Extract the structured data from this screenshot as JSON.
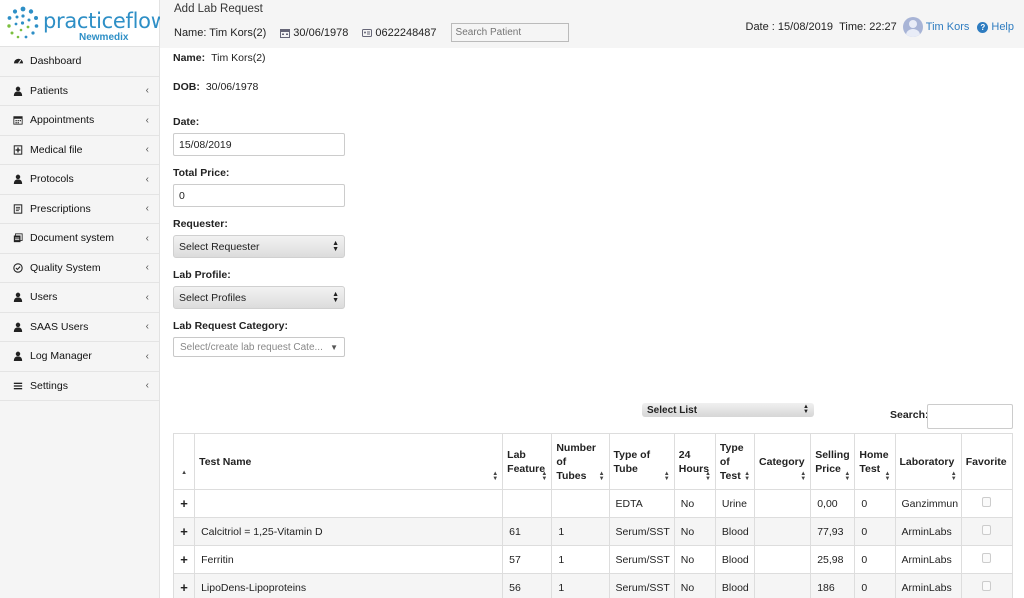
{
  "brand": {
    "name": "practiceflow",
    "sub": "Newmedix"
  },
  "sidebar": {
    "items": [
      {
        "label": "Dashboard",
        "icon": "dashboard-icon",
        "chevron": false
      },
      {
        "label": "Patients",
        "icon": "user-icon",
        "chevron": true
      },
      {
        "label": "Appointments",
        "icon": "calendar-icon",
        "chevron": true
      },
      {
        "label": "Medical file",
        "icon": "medical-file-icon",
        "chevron": true
      },
      {
        "label": "Protocols",
        "icon": "user-icon",
        "chevron": true
      },
      {
        "label": "Prescriptions",
        "icon": "prescription-icon",
        "chevron": true
      },
      {
        "label": "Document system",
        "icon": "document-icon",
        "chevron": true
      },
      {
        "label": "Quality System",
        "icon": "check-circle-icon",
        "chevron": true
      },
      {
        "label": "Users",
        "icon": "user-icon",
        "chevron": true
      },
      {
        "label": "SAAS Users",
        "icon": "user-icon",
        "chevron": true
      },
      {
        "label": "Log Manager",
        "icon": "user-icon",
        "chevron": true
      },
      {
        "label": "Settings",
        "icon": "settings-icon",
        "chevron": true
      }
    ]
  },
  "header": {
    "title": "Add Lab Request",
    "patient_name": "Name: Tim Kors(2)",
    "dob": "30/06/1978",
    "phone": "0622248487",
    "search_placeholder": "Search Patient",
    "date": "Date : 15/08/2019",
    "time": "Time: 22:27",
    "user": "Tim Kors",
    "help": "Help"
  },
  "form": {
    "name_label": "Name:",
    "name_value": "Tim Kors(2)",
    "dob_label": "DOB:",
    "dob_value": "30/06/1978",
    "date_label": "Date:",
    "date_value": "15/08/2019",
    "total_label": "Total Price:",
    "total_value": "0",
    "requester_label": "Requester:",
    "requester_value": "Select Requester",
    "profile_label": "Lab Profile:",
    "profile_value": "Select Profiles",
    "category_label": "Lab Request Category:",
    "category_placeholder": "Select/create lab request Cate..."
  },
  "table_controls": {
    "select_list": "Select List",
    "search_label": "Search:"
  },
  "table": {
    "columns": [
      "",
      "Test Name",
      "Lab Feature",
      "Number of Tubes",
      "Type of Tube",
      "24 Hours",
      "Type of Test",
      "Category",
      "Selling Price",
      "Home Test",
      "Laboratory",
      "Favorite"
    ],
    "rows": [
      [
        "+",
        "",
        "",
        "",
        "EDTA",
        "No",
        "Urine",
        "",
        "0,00",
        "0",
        "Ganzimmun"
      ],
      [
        "+",
        "Calcitriol = 1,25-Vitamin D",
        "61",
        "1",
        "Serum/SST",
        "No",
        "Blood",
        "",
        "77,93",
        "0",
        "ArminLabs"
      ],
      [
        "+",
        "Ferritin",
        "57",
        "1",
        "Serum/SST",
        "No",
        "Blood",
        "",
        "25,98",
        "0",
        "ArminLabs"
      ],
      [
        "+",
        "LipoDens-Lipoproteins",
        "56",
        "1",
        "Serum/SST",
        "No",
        "Blood",
        "",
        "186",
        "0",
        "ArminLabs"
      ]
    ]
  },
  "colors": {
    "brand": "#2e8fc6",
    "link": "#2e7cc0",
    "sidebar_bg": "#f5f5f5"
  }
}
